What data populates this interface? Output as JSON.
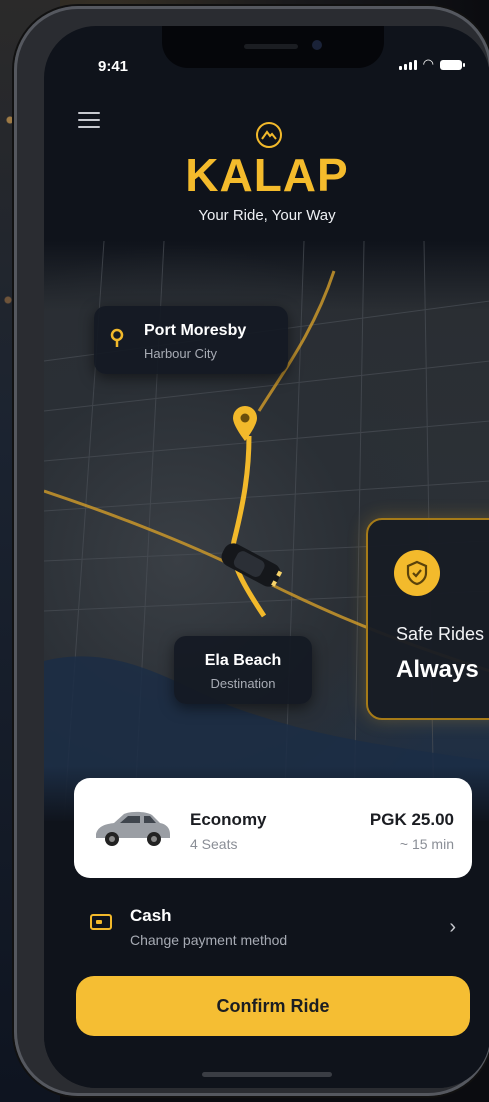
{
  "status_bar": {
    "time": "9:41"
  },
  "app": {
    "brand": "KALAP",
    "tagline": "Your Ride, Your Way"
  },
  "map": {
    "origin": {
      "title": "Port Moresby",
      "subtitle": "Harbour City"
    },
    "destination": {
      "title": "Ela Beach",
      "subtitle": "Destination"
    }
  },
  "promo": {
    "line1": "Safe Rides",
    "line2": "Always"
  },
  "ride_option": {
    "name": "Economy",
    "seats": "4 Seats",
    "price": "PGK 25.00",
    "eta": "~ 15 min"
  },
  "payment": {
    "method": "Cash",
    "hint": "Change payment method"
  },
  "actions": {
    "confirm_label": "Confirm Ride"
  },
  "colors": {
    "accent": "#f4bb2c",
    "background": "#0f131b",
    "card": "#ffffff"
  },
  "icons": [
    "menu-icon",
    "logo-icon",
    "location-pin-icon",
    "car-icon",
    "shield-check-icon",
    "cash-icon",
    "chevron-right-icon",
    "signal-icon",
    "wifi-icon",
    "battery-icon"
  ]
}
